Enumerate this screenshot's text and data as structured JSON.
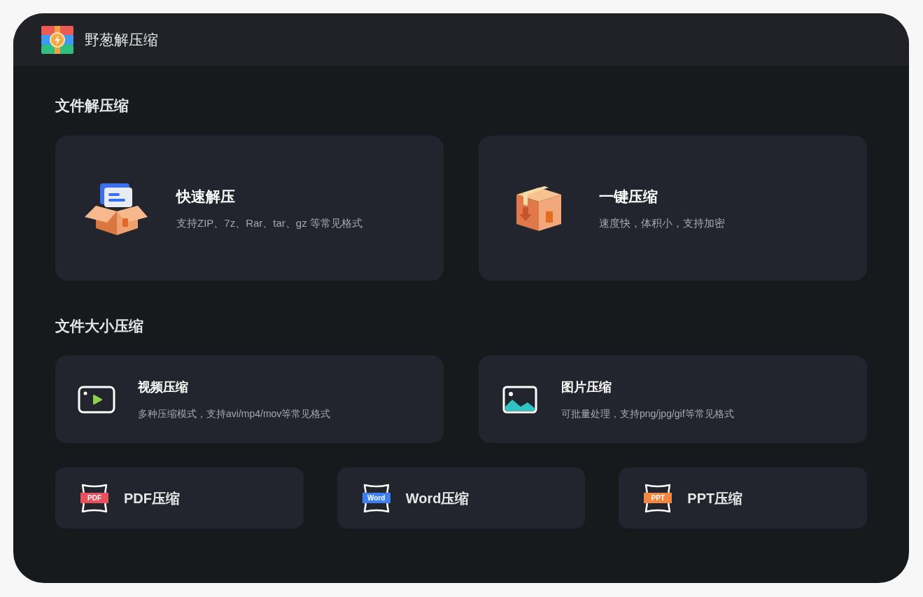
{
  "app": {
    "title": "野葱解压缩"
  },
  "sections": [
    {
      "title": "文件解压缩",
      "cards": [
        {
          "kind": "extract",
          "title": "快速解压",
          "subtitle": "支持ZIP、7z、Rar、tar、gz 等常见格式"
        },
        {
          "kind": "compress",
          "title": "一键压缩",
          "subtitle": "速度快，体积小，支持加密"
        }
      ]
    },
    {
      "title": "文件大小压缩",
      "cards": [
        {
          "kind": "video",
          "title": "视频压缩",
          "subtitle": "多种压缩模式，支持avi/mp4/mov等常见格式"
        },
        {
          "kind": "image",
          "title": "图片压缩",
          "subtitle": "可批量处理，支持png/jpg/gif等常见格式"
        }
      ],
      "doc_cards": [
        {
          "badge": "PDF",
          "title": "PDF压缩",
          "color": "#ec4f5c"
        },
        {
          "badge": "Word",
          "title": "Word压缩",
          "color": "#3d7ef0"
        },
        {
          "badge": "PPT",
          "title": "PPT压缩",
          "color": "#f3873f"
        }
      ]
    }
  ]
}
